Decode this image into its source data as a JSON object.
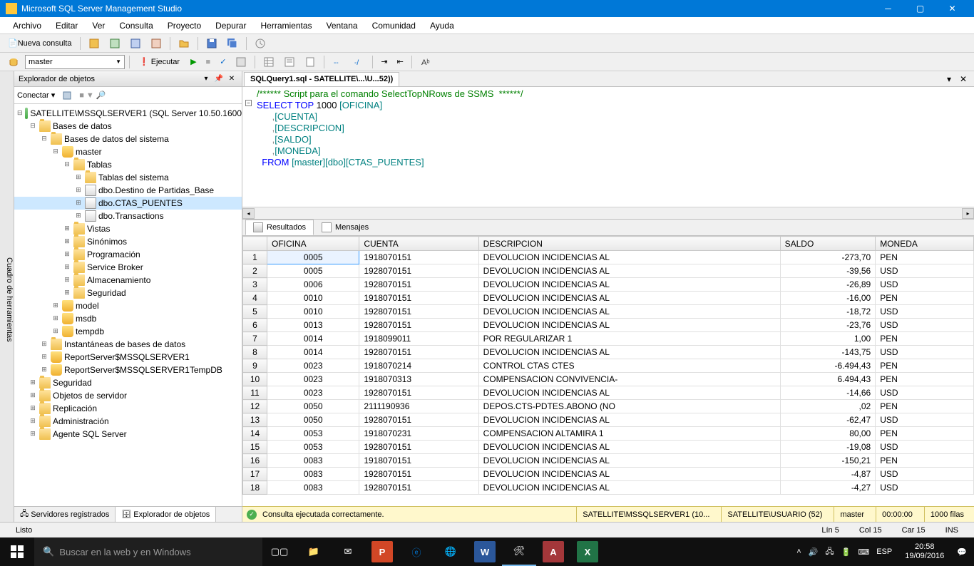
{
  "titlebar": {
    "title": "Microsoft SQL Server Management Studio"
  },
  "menubar": [
    "Archivo",
    "Editar",
    "Ver",
    "Consulta",
    "Proyecto",
    "Depurar",
    "Herramientas",
    "Ventana",
    "Comunidad",
    "Ayuda"
  ],
  "toolbar1": {
    "nuevaConsulta": "Nueva consulta"
  },
  "toolbar2": {
    "database": "master",
    "execute": "Ejecutar"
  },
  "sidebarTab": "Cuadro de herramientas",
  "objectExplorer": {
    "title": "Explorador de objetos",
    "connect": "Conectar ▾",
    "tree": [
      {
        "indent": 0,
        "exp": "−",
        "icon": "server",
        "label": "SATELLITE\\MSSQLSERVER1 (SQL Server 10.50.1600"
      },
      {
        "indent": 1,
        "exp": "−",
        "icon": "folder",
        "label": "Bases de datos"
      },
      {
        "indent": 2,
        "exp": "−",
        "icon": "folder",
        "label": "Bases de datos del sistema"
      },
      {
        "indent": 3,
        "exp": "−",
        "icon": "db",
        "label": "master"
      },
      {
        "indent": 4,
        "exp": "−",
        "icon": "folder",
        "label": "Tablas"
      },
      {
        "indent": 5,
        "exp": "+",
        "icon": "folder",
        "label": "Tablas del sistema"
      },
      {
        "indent": 5,
        "exp": "+",
        "icon": "table",
        "label": "dbo.Destino de Partidas_Base"
      },
      {
        "indent": 5,
        "exp": "+",
        "icon": "table",
        "label": "dbo.CTAS_PUENTES",
        "selected": true
      },
      {
        "indent": 5,
        "exp": "+",
        "icon": "table",
        "label": "dbo.Transactions"
      },
      {
        "indent": 4,
        "exp": "+",
        "icon": "folder",
        "label": "Vistas"
      },
      {
        "indent": 4,
        "exp": "+",
        "icon": "folder",
        "label": "Sinónimos"
      },
      {
        "indent": 4,
        "exp": "+",
        "icon": "folder",
        "label": "Programación"
      },
      {
        "indent": 4,
        "exp": "+",
        "icon": "folder",
        "label": "Service Broker"
      },
      {
        "indent": 4,
        "exp": "+",
        "icon": "folder",
        "label": "Almacenamiento"
      },
      {
        "indent": 4,
        "exp": "+",
        "icon": "folder",
        "label": "Seguridad"
      },
      {
        "indent": 3,
        "exp": "+",
        "icon": "db",
        "label": "model"
      },
      {
        "indent": 3,
        "exp": "+",
        "icon": "db",
        "label": "msdb"
      },
      {
        "indent": 3,
        "exp": "+",
        "icon": "db",
        "label": "tempdb"
      },
      {
        "indent": 2,
        "exp": "+",
        "icon": "folder",
        "label": "Instantáneas de bases de datos"
      },
      {
        "indent": 2,
        "exp": "+",
        "icon": "db",
        "label": "ReportServer$MSSQLSERVER1"
      },
      {
        "indent": 2,
        "exp": "+",
        "icon": "db",
        "label": "ReportServer$MSSQLSERVER1TempDB"
      },
      {
        "indent": 1,
        "exp": "+",
        "icon": "folder",
        "label": "Seguridad"
      },
      {
        "indent": 1,
        "exp": "+",
        "icon": "folder",
        "label": "Objetos de servidor"
      },
      {
        "indent": 1,
        "exp": "+",
        "icon": "folder",
        "label": "Replicación"
      },
      {
        "indent": 1,
        "exp": "+",
        "icon": "folder",
        "label": "Administración"
      },
      {
        "indent": 1,
        "exp": "+",
        "icon": "folder",
        "label": "Agente SQL Server"
      }
    ],
    "bottomTabs": {
      "registered": "Servidores registrados",
      "explorer": "Explorador de objetos"
    }
  },
  "docTab": "SQLQuery1.sql - SATELLITE\\...\\U...52))",
  "sql": {
    "l1": "/****** Script para el comando SelectTopNRows de SSMS  ******/",
    "l2a": "SELECT",
    "l2b": " TOP",
    "l2c": " 1000 ",
    "l2d": "[OFICINA]",
    "l3a": "      ,",
    "l3b": "[CUENTA]",
    "l4a": "      ,",
    "l4b": "[DESCRIPCION]",
    "l5a": "      ,",
    "l5b": "[SALDO]",
    "l6a": "      ,",
    "l6b": "[MONEDA]",
    "l7a": "  FROM ",
    "l7b": "[master]",
    ".": ".",
    "l7c": "[dbo]",
    "l7d": "[CTAS_PUENTES]"
  },
  "resultTabs": {
    "results": "Resultados",
    "messages": "Mensajes"
  },
  "grid": {
    "headers": [
      "",
      "OFICINA",
      "CUENTA",
      "DESCRIPCION",
      "SALDO",
      "MONEDA"
    ],
    "rows": [
      [
        "1",
        "0005",
        "1918070151",
        "DEVOLUCION INCIDENCIAS AL",
        "-273,70",
        "PEN"
      ],
      [
        "2",
        "0005",
        "1928070151",
        "DEVOLUCION INCIDENCIAS AL",
        "-39,56",
        "USD"
      ],
      [
        "3",
        "0006",
        "1928070151",
        "DEVOLUCION INCIDENCIAS AL",
        "-26,89",
        "USD"
      ],
      [
        "4",
        "0010",
        "1918070151",
        "DEVOLUCION INCIDENCIAS AL",
        "-16,00",
        "PEN"
      ],
      [
        "5",
        "0010",
        "1928070151",
        "DEVOLUCION INCIDENCIAS AL",
        "-18,72",
        "USD"
      ],
      [
        "6",
        "0013",
        "1928070151",
        "DEVOLUCION INCIDENCIAS AL",
        "-23,76",
        "USD"
      ],
      [
        "7",
        "0014",
        "1918099011",
        "POR REGULARIZAR 1",
        "1,00",
        "PEN"
      ],
      [
        "8",
        "0014",
        "1928070151",
        "DEVOLUCION INCIDENCIAS AL",
        "-143,75",
        "USD"
      ],
      [
        "9",
        "0023",
        "1918070214",
        "CONTROL  CTAS CTES",
        "-6.494,43",
        "PEN"
      ],
      [
        "10",
        "0023",
        "1918070313",
        "COMPENSACION CONVIVENCIA-",
        "6.494,43",
        "PEN"
      ],
      [
        "11",
        "0023",
        "1928070151",
        "DEVOLUCION INCIDENCIAS AL",
        "-14,66",
        "USD"
      ],
      [
        "12",
        "0050",
        "2111190936",
        "DEPOS.CTS-PDTES.ABONO (NO",
        ",02",
        "PEN"
      ],
      [
        "13",
        "0050",
        "1928070151",
        "DEVOLUCION INCIDENCIAS AL",
        "-62,47",
        "USD"
      ],
      [
        "14",
        "0053",
        "1918070231",
        "COMPENSACION ALTAMIRA 1",
        "80,00",
        "PEN"
      ],
      [
        "15",
        "0053",
        "1928070151",
        "DEVOLUCION INCIDENCIAS AL",
        "-19,08",
        "USD"
      ],
      [
        "16",
        "0083",
        "1918070151",
        "DEVOLUCION INCIDENCIAS AL",
        "-150,21",
        "PEN"
      ],
      [
        "17",
        "0083",
        "1928070151",
        "DEVOLUCION INCIDENCIAS AL",
        "-4,87",
        "USD"
      ],
      [
        "18",
        "0083",
        "1928070151",
        "DEVOLUCION INCIDENCIAS AL",
        "-4,27",
        "USD"
      ]
    ]
  },
  "queryStatus": {
    "message": "Consulta ejecutada correctamente.",
    "server": "SATELLITE\\MSSQLSERVER1 (10...",
    "user": "SATELLITE\\USUARIO (52)",
    "db": "master",
    "time": "00:00:00",
    "rows": "1000 filas"
  },
  "appStatus": {
    "ready": "Listo",
    "line": "Lín 5",
    "col": "Col 15",
    "car": "Car 15",
    "ins": "INS"
  },
  "taskbar": {
    "search": "Buscar en la web y en Windows",
    "lang": "ESP",
    "time": "20:58",
    "date": "19/09/2016"
  }
}
